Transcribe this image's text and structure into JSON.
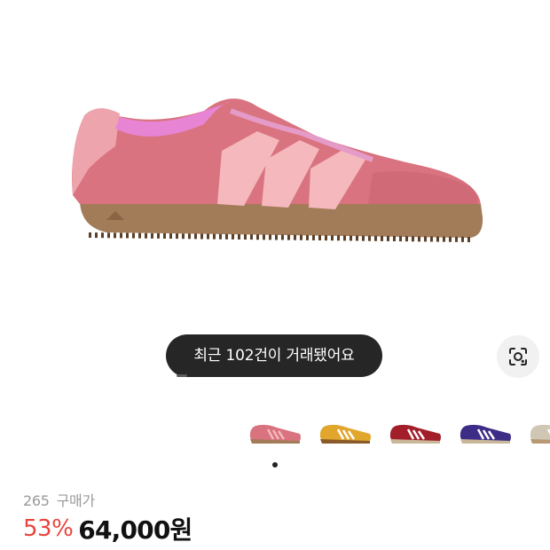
{
  "product": {
    "image_icon": "sneaker-image",
    "recent_trades_toast": "최근 102건이 거래됐어요",
    "size": "265",
    "price_label": "구매가",
    "discount": "53%",
    "price": "64,000원"
  },
  "colorways": [
    {
      "name": "pink",
      "upper": "#d9737f",
      "stripe": "#f4b8bd",
      "sole": "#a27b58"
    },
    {
      "name": "yellow",
      "upper": "#e1a62c",
      "stripe": "#ffffff",
      "sole": "#8a5a2a"
    },
    {
      "name": "burgundy",
      "upper": "#a21f2a",
      "stripe": "#ffffff",
      "sole": "#c9b79a"
    },
    {
      "name": "purple",
      "upper": "#3e2d86",
      "stripe": "#ffffff",
      "sole": "#c9b79a"
    },
    {
      "name": "beige",
      "upper": "#cfc7b3",
      "stripe": "#ffffff",
      "sole": "#b89872"
    }
  ],
  "colors": {
    "discount": "#e8453c",
    "toast_bg": "#262626"
  }
}
